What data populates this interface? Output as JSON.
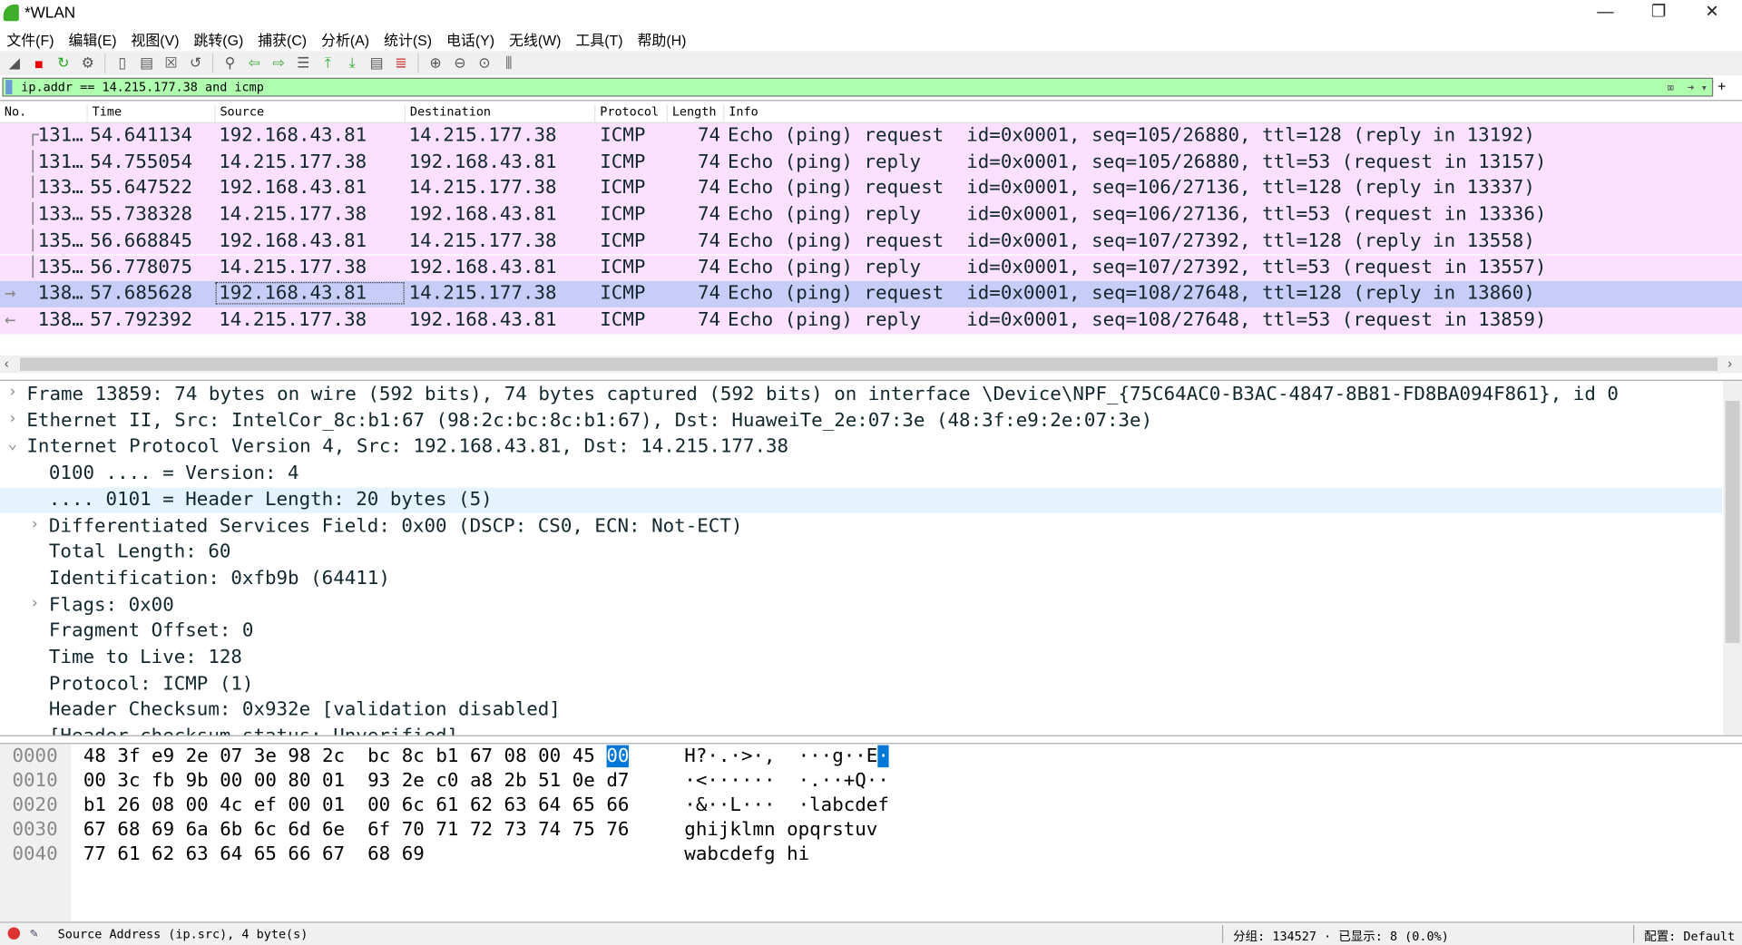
{
  "window": {
    "title": "*WLAN",
    "controls": [
      "minimize",
      "restore",
      "close"
    ]
  },
  "menu": [
    "文件(F)",
    "编辑(E)",
    "视图(V)",
    "跳转(G)",
    "捕获(C)",
    "分析(A)",
    "统计(S)",
    "电话(Y)",
    "无线(W)",
    "工具(T)",
    "帮助(H)"
  ],
  "toolbar": [
    "shark-fin-icon",
    "stop-icon",
    "restart-icon",
    "options-icon",
    "open-icon",
    "file-icon",
    "close-file-icon",
    "reload-icon",
    "find-icon",
    "back-icon",
    "forward-icon",
    "goto-icon",
    "first-icon",
    "last-icon",
    "autoscroll-icon",
    "colorize-icon",
    "zoom-in-icon",
    "zoom-out-icon",
    "zoom-normal-icon",
    "resize-columns-icon"
  ],
  "filter": {
    "value": "ip.addr == 14.215.177.38 and icmp",
    "bg": "#afffaf"
  },
  "columns": [
    "No.",
    "Time",
    "Source",
    "Destination",
    "Protocol",
    "Length",
    "Info"
  ],
  "packets": [
    {
      "no": "131…",
      "time": "54.641134",
      "src": "192.168.43.81",
      "dst": "14.215.177.38",
      "proto": "ICMP",
      "len": "74",
      "info": "Echo (ping) request  id=0x0001, seq=105/26880, ttl=128 (reply in 13192)"
    },
    {
      "no": "131…",
      "time": "54.755054",
      "src": "14.215.177.38",
      "dst": "192.168.43.81",
      "proto": "ICMP",
      "len": "74",
      "info": "Echo (ping) reply    id=0x0001, seq=105/26880, ttl=53 (request in 13157)"
    },
    {
      "no": "133…",
      "time": "55.647522",
      "src": "192.168.43.81",
      "dst": "14.215.177.38",
      "proto": "ICMP",
      "len": "74",
      "info": "Echo (ping) request  id=0x0001, seq=106/27136, ttl=128 (reply in 13337)"
    },
    {
      "no": "133…",
      "time": "55.738328",
      "src": "14.215.177.38",
      "dst": "192.168.43.81",
      "proto": "ICMP",
      "len": "74",
      "info": "Echo (ping) reply    id=0x0001, seq=106/27136, ttl=53 (request in 13336)"
    },
    {
      "no": "135…",
      "time": "56.668845",
      "src": "192.168.43.81",
      "dst": "14.215.177.38",
      "proto": "ICMP",
      "len": "74",
      "info": "Echo (ping) request  id=0x0001, seq=107/27392, ttl=128 (reply in 13558)"
    },
    {
      "no": "135…",
      "time": "56.778075",
      "src": "14.215.177.38",
      "dst": "192.168.43.81",
      "proto": "ICMP",
      "len": "74",
      "info": "Echo (ping) reply    id=0x0001, seq=107/27392, ttl=53 (request in 13557)"
    },
    {
      "no": "138…",
      "time": "57.685628",
      "src": "192.168.43.81",
      "dst": "14.215.177.38",
      "proto": "ICMP",
      "len": "74",
      "info": "Echo (ping) request  id=0x0001, seq=108/27648, ttl=128 (reply in 13860)",
      "selected": true
    },
    {
      "no": "138…",
      "time": "57.792392",
      "src": "14.215.177.38",
      "dst": "192.168.43.81",
      "proto": "ICMP",
      "len": "74",
      "info": "Echo (ping) reply    id=0x0001, seq=108/27648, ttl=53 (request in 13859)"
    }
  ],
  "details": [
    {
      "text": "Frame 13859: 74 bytes on wire (592 bits), 74 bytes captured (592 bits) on interface \\Device\\NPF_{75C64AC0-B3AC-4847-8B81-FD8BA094F861}, id 0",
      "level": 0,
      "toggle": "collapsed"
    },
    {
      "text": "Ethernet II, Src: IntelCor_8c:b1:67 (98:2c:bc:8c:b1:67), Dst: HuaweiTe_2e:07:3e (48:3f:e9:2e:07:3e)",
      "level": 0,
      "toggle": "collapsed"
    },
    {
      "text": "Internet Protocol Version 4, Src: 192.168.43.81, Dst: 14.215.177.38",
      "level": 0,
      "toggle": "expanded"
    },
    {
      "text": "0100 .... = Version: 4",
      "level": 1
    },
    {
      "text": ".... 0101 = Header Length: 20 bytes (5)",
      "level": 1,
      "highlight": true
    },
    {
      "text": "Differentiated Services Field: 0x00 (DSCP: CS0, ECN: Not-ECT)",
      "level": 1,
      "toggle": "collapsed"
    },
    {
      "text": "Total Length: 60",
      "level": 1
    },
    {
      "text": "Identification: 0xfb9b (64411)",
      "level": 1
    },
    {
      "text": "Flags: 0x00",
      "level": 1,
      "toggle": "collapsed"
    },
    {
      "text": "Fragment Offset: 0",
      "level": 1
    },
    {
      "text": "Time to Live: 128",
      "level": 1
    },
    {
      "text": "Protocol: ICMP (1)",
      "level": 1
    },
    {
      "text": "Header Checksum: 0x932e [validation disabled]",
      "level": 1
    },
    {
      "text": "[Header checksum status: Unverified]",
      "level": 1
    }
  ],
  "bytes": [
    {
      "off": "0000",
      "hex": "48 3f e9 2e 07 3e 98 2c  bc 8c b1 67 08 00 45 ",
      "hexsel": "00",
      "asc": "H?·.·>·,  ···g··E",
      "ascsel": "·"
    },
    {
      "off": "0010",
      "hex": "00 3c fb 9b 00 00 80 01  93 2e c0 a8 2b 51 0e d7",
      "asc": "·<······  ·.··+Q··"
    },
    {
      "off": "0020",
      "hex": "b1 26 08 00 4c ef 00 01  00 6c 61 62 63 64 65 66",
      "asc": "·&··L···  ·labcdef"
    },
    {
      "off": "0030",
      "hex": "67 68 69 6a 6b 6c 6d 6e  6f 70 71 72 73 74 75 76",
      "asc": "ghijklmn opqrstuv"
    },
    {
      "off": "0040",
      "hex": "77 61 62 63 64 65 66 67  68 69",
      "asc": "wabcdefg hi"
    }
  ],
  "status": {
    "message": "Source Address (ip.src), 4 byte(s)",
    "packets": "分组: 134527 · 已显示: 8 (0.0%)",
    "profile": "配置: Default"
  },
  "colors": {
    "row": "#fce0ff",
    "selected": "#c8cdf8",
    "detail_highlight": "#e5f3ff",
    "byte_select": "#0078d7"
  }
}
